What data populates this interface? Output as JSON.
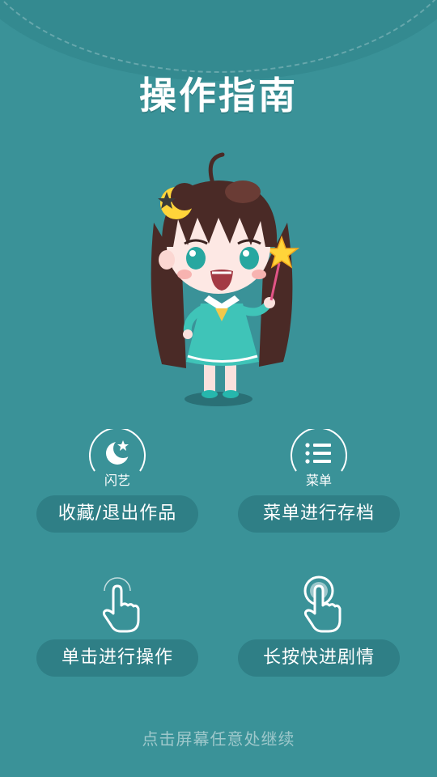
{
  "title": "操作指南",
  "features": [
    {
      "icon": "moon-icon",
      "icon_caption": "闪艺",
      "label": "收藏/退出作品"
    },
    {
      "icon": "menu-list-icon",
      "icon_caption": "菜单",
      "label": "菜单进行存档"
    },
    {
      "icon": "tap-hand-icon",
      "label": "单击进行操作"
    },
    {
      "icon": "long-press-hand-icon",
      "label": "长按快进剧情"
    }
  ],
  "hint": "点击屏幕任意处继续",
  "colors": {
    "background": "#3a9298",
    "pill": "#2f7f86",
    "text": "#ffffff",
    "hint_text": "#9ec8cb"
  }
}
